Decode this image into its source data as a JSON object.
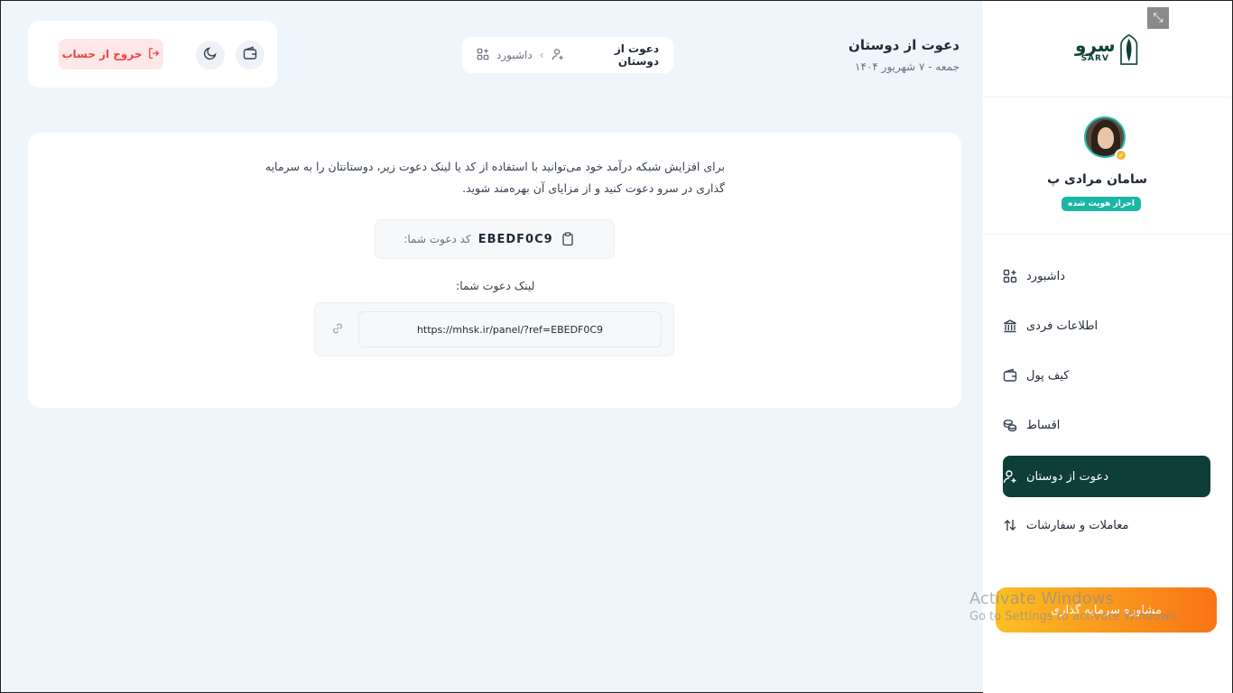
{
  "window": {
    "fullscreen_icon": "collapse-icon"
  },
  "brand": {
    "name_fa": "سرو",
    "name_en": "SARV",
    "color": "#0f4236"
  },
  "user": {
    "name": "سامان مرادی پ",
    "verified_label": "احراز هویت شده"
  },
  "sidebar": {
    "items": [
      {
        "label": "داشبورد",
        "icon": "grid-plus-icon",
        "active": false
      },
      {
        "label": "اطلاعات فردی",
        "icon": "bank-icon",
        "active": false
      },
      {
        "label": "کیف پول",
        "icon": "wallet-icon",
        "active": false
      },
      {
        "label": "اقساط",
        "icon": "coins-icon",
        "active": false
      },
      {
        "label": "دعوت از دوستان",
        "icon": "user-plus-icon",
        "active": true
      },
      {
        "label": "معاملات و سفارشات",
        "icon": "arrows-updown-icon",
        "active": false
      }
    ],
    "consult_button": "مشاوره سرمایه گذاری"
  },
  "header": {
    "title": "دعوت از دوستان",
    "date": "جمعه - ۷ شهریور ۱۴۰۴",
    "breadcrumb": {
      "home": "داشبورد",
      "current": "دعوت از دوستان"
    },
    "logout_label": "خروج از حساب"
  },
  "invite": {
    "intro": "برای افزایش شبکه درآمد خود می‌توانید با استفاده از کد یا لینک دعوت زیر، دوستانتان را به سرمایه گذاری در سرو دعوت کنید و از مزایای آن بهره‌مند شوید.",
    "code_label": "کد دعوت شما:",
    "code_value": "EBEDF0C9",
    "link_label": "لینک دعوت شما:",
    "link_value": "https://mhsk.ir/panel/?ref=EBEDF0C9"
  },
  "watermark": {
    "line1": "Activate Windows",
    "line2": "Go to Settings to activate Windows."
  },
  "colors": {
    "accent": "#0f3d38",
    "badge": "#1cb6a7",
    "danger": "#ef4444",
    "bg": "#eef6fc"
  }
}
